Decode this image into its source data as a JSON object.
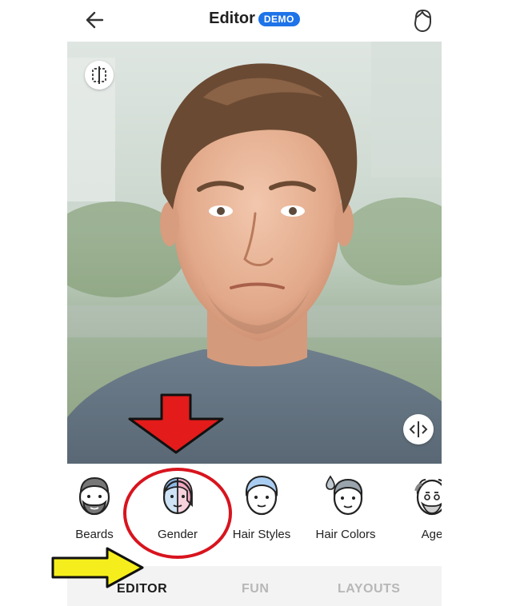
{
  "header": {
    "title": "Editor",
    "badge": "DEMO"
  },
  "tools": [
    {
      "label": "Beards",
      "icon": "beard-face-icon"
    },
    {
      "label": "Gender",
      "icon": "gender-face-icon"
    },
    {
      "label": "Hair Styles",
      "icon": "hair-styles-face-icon"
    },
    {
      "label": "Hair Colors",
      "icon": "hair-colors-face-icon"
    },
    {
      "label": "Age",
      "icon": "age-face-icon"
    }
  ],
  "tabs": [
    {
      "label": "EDITOR",
      "active": true
    },
    {
      "label": "FUN",
      "active": false
    },
    {
      "label": "LAYOUTS",
      "active": false
    }
  ],
  "colors": {
    "accent": "#1e73e8",
    "annotation_red": "#e31b1b",
    "annotation_yellow": "#f5ee1c"
  }
}
